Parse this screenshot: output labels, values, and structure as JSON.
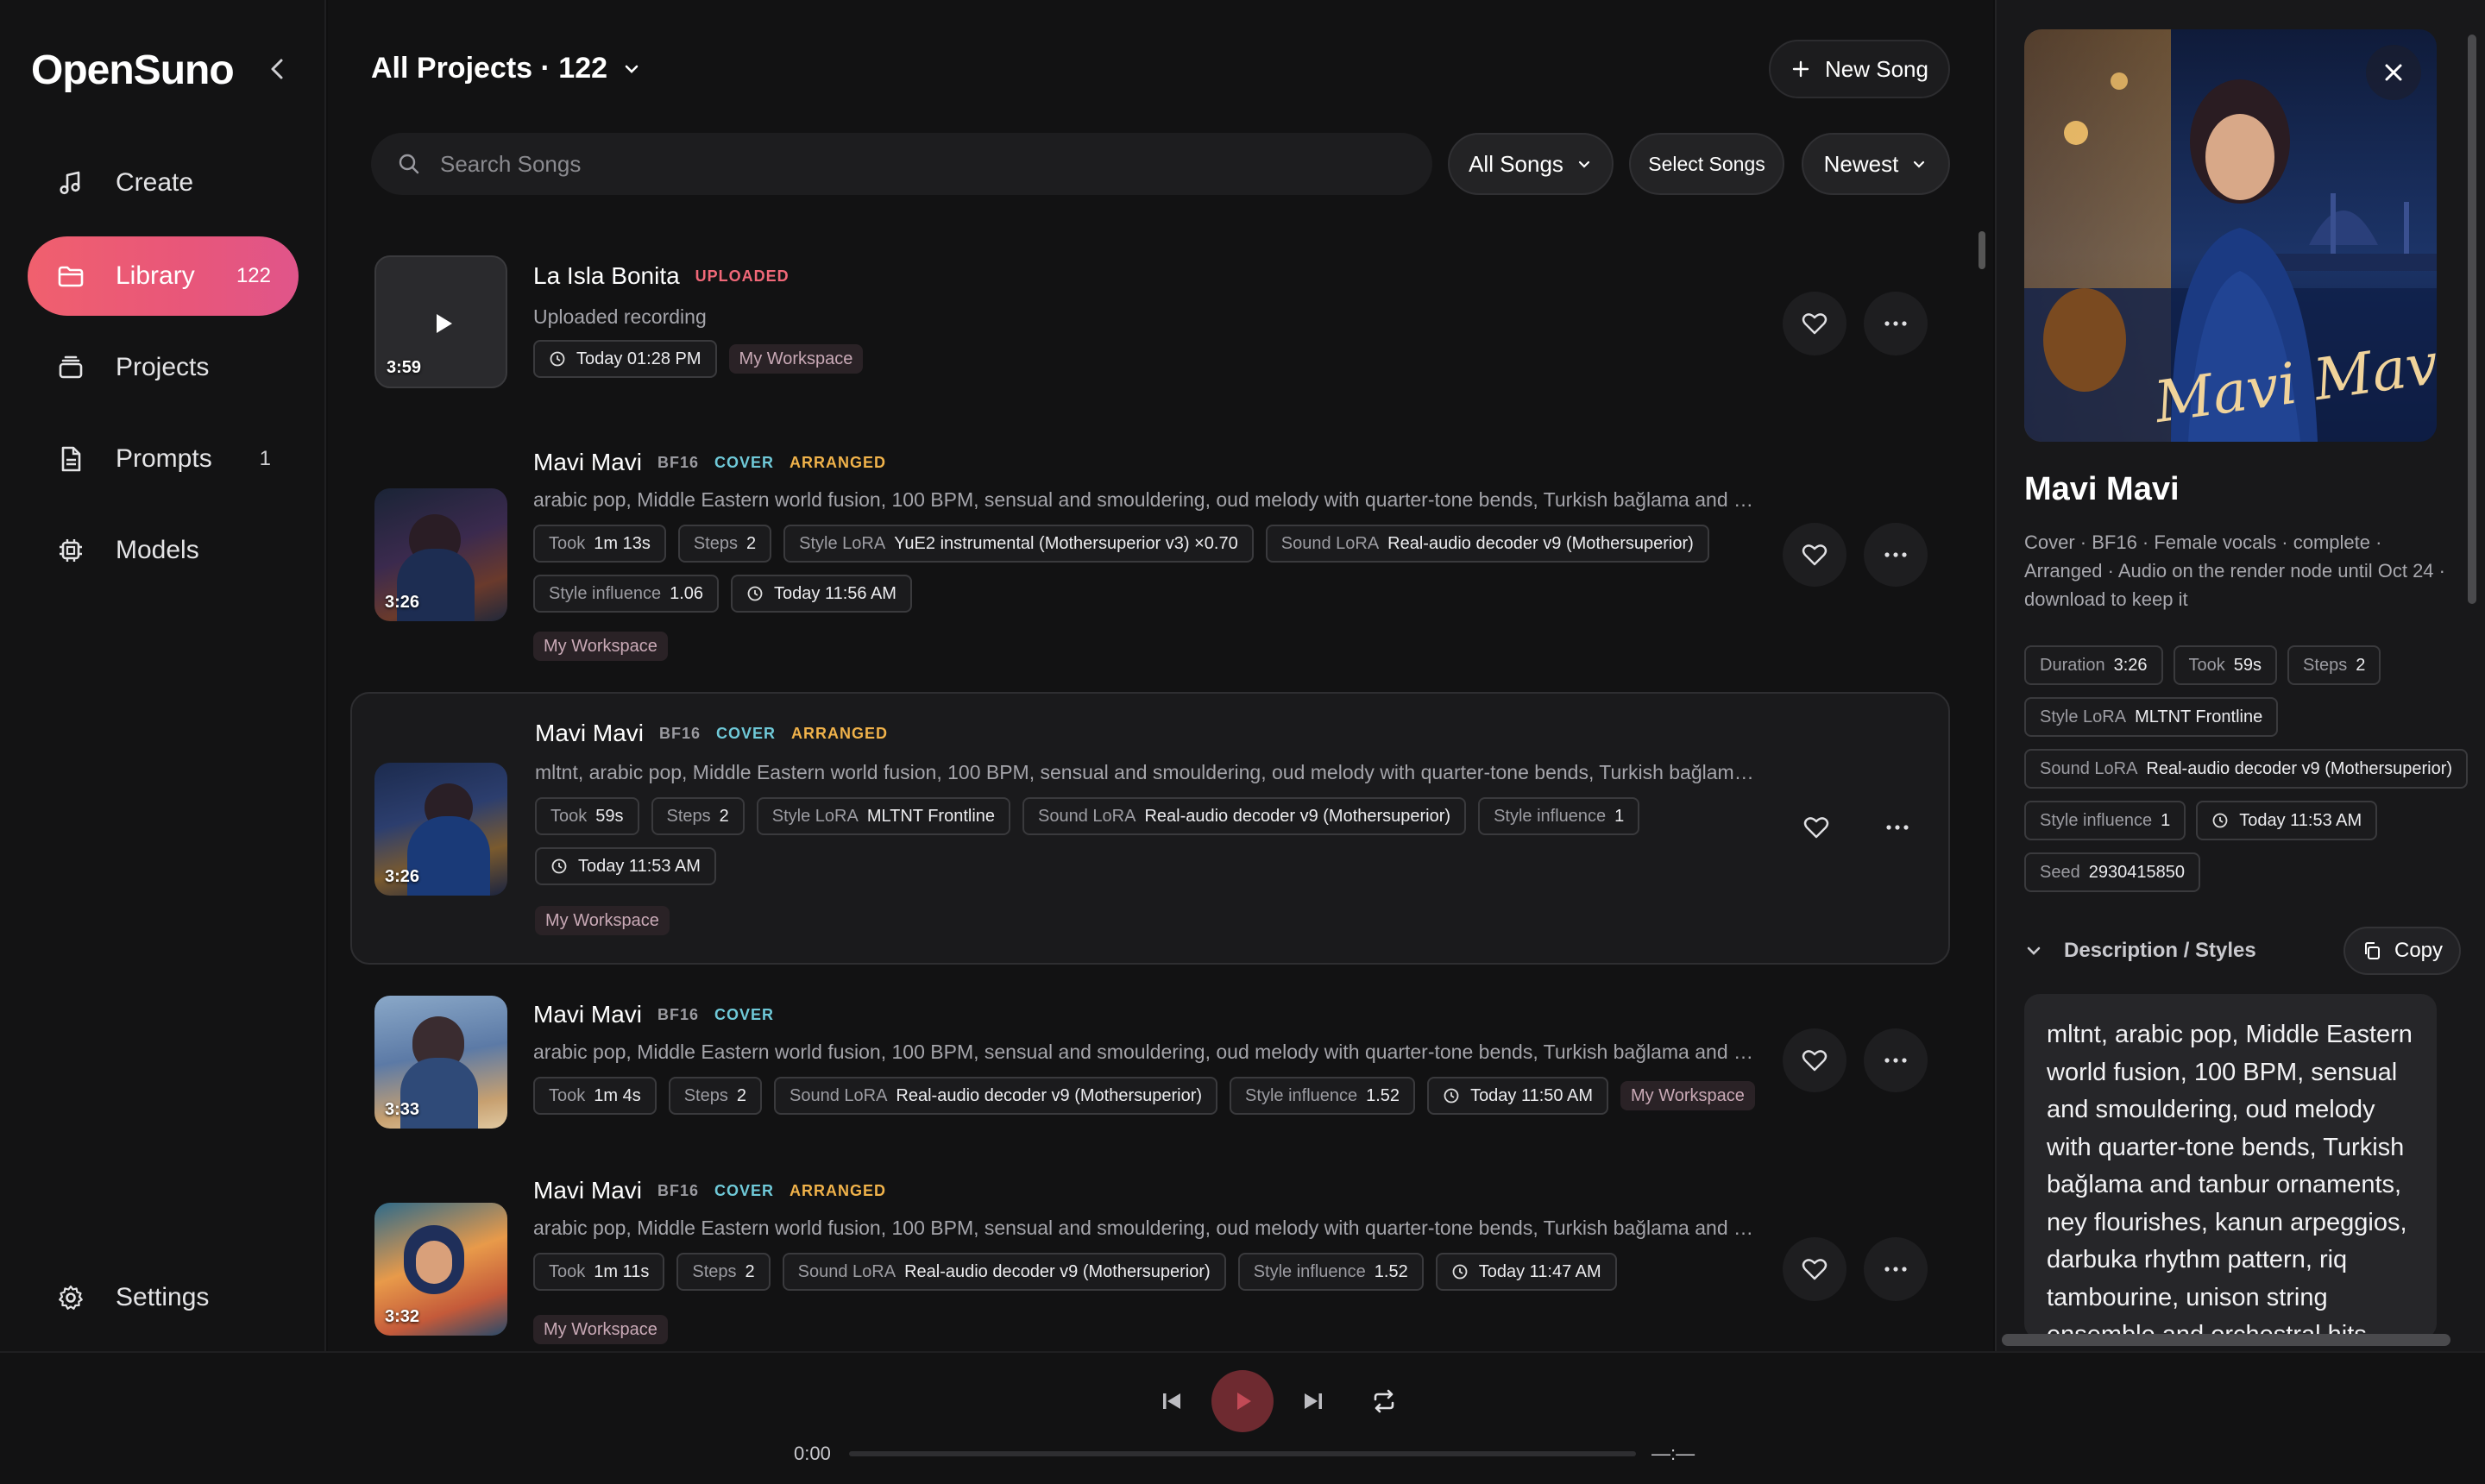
{
  "app": {
    "name": "OpenSuno"
  },
  "sidebar": {
    "items": [
      {
        "label": "Create",
        "icon": "music-note-icon",
        "count": ""
      },
      {
        "label": "Library",
        "icon": "folder-icon",
        "count": "122"
      },
      {
        "label": "Projects",
        "icon": "projects-icon",
        "count": ""
      },
      {
        "label": "Prompts",
        "icon": "document-icon",
        "count": "1"
      },
      {
        "label": "Models",
        "icon": "chip-icon",
        "count": ""
      }
    ],
    "settings_label": "Settings"
  },
  "header": {
    "title": "All Projects · 122",
    "new_song_label": "New Song",
    "search_placeholder": "Search Songs",
    "filter_label": "All Songs",
    "select_label": "Select Songs",
    "sort_label": "Newest"
  },
  "songs": [
    {
      "title": "La Isla Bonita",
      "tags": [
        "UPLOADED"
      ],
      "desc": "Uploaded recording",
      "duration": "3:59",
      "chips": [
        {
          "label": "",
          "value": "Today 01:28 PM",
          "clock": true
        }
      ],
      "workspace": "My Workspace"
    },
    {
      "title": "Mavi Mavi",
      "tags": [
        "BF16",
        "COVER",
        "ARRANGED"
      ],
      "desc": "arabic pop, Middle Eastern world fusion, 100 BPM, sensual and smouldering, oud melody with quarter-tone bends, Turkish bağlama and tanbur ornaments, ney flourishes, kanun arpeggios",
      "duration": "3:26",
      "chips": [
        {
          "label": "Took",
          "value": "1m 13s"
        },
        {
          "label": "Steps",
          "value": "2"
        },
        {
          "label": "Style LoRA",
          "value": "YuE2 instrumental (Mothersuperior v3) ×0.70"
        },
        {
          "label": "Sound LoRA",
          "value": "Real-audio decoder v9 (Mothersuperior)"
        },
        {
          "label": "Style influence",
          "value": "1.06"
        },
        {
          "label": "",
          "value": "Today 11:56 AM",
          "clock": true
        }
      ],
      "workspace": "My Workspace"
    },
    {
      "title": "Mavi Mavi",
      "tags": [
        "BF16",
        "COVER",
        "ARRANGED"
      ],
      "desc": "mltnt, arabic pop, Middle Eastern world fusion, 100 BPM, sensual and smouldering, oud melody with quarter-tone bends, Turkish bağlama and tanbur ornaments, ney flourishes",
      "duration": "3:26",
      "chips": [
        {
          "label": "Took",
          "value": "59s"
        },
        {
          "label": "Steps",
          "value": "2"
        },
        {
          "label": "Style LoRA",
          "value": "MLTNT Frontline"
        },
        {
          "label": "Sound LoRA",
          "value": "Real-audio decoder v9 (Mothersuperior)"
        },
        {
          "label": "Style influence",
          "value": "1"
        },
        {
          "label": "",
          "value": "Today 11:53 AM",
          "clock": true
        }
      ],
      "workspace": "My Workspace"
    },
    {
      "title": "Mavi Mavi",
      "tags": [
        "BF16",
        "COVER"
      ],
      "desc": "arabic pop, Middle Eastern world fusion, 100 BPM, sensual and smouldering, oud melody with quarter-tone bends, Turkish bağlama and tanbur ornaments, ney flourishes, kanun arpeggios",
      "duration": "3:33",
      "chips": [
        {
          "label": "Took",
          "value": "1m 4s"
        },
        {
          "label": "Steps",
          "value": "2"
        },
        {
          "label": "Sound LoRA",
          "value": "Real-audio decoder v9 (Mothersuperior)"
        },
        {
          "label": "Style influence",
          "value": "1.52"
        },
        {
          "label": "",
          "value": "Today 11:50 AM",
          "clock": true
        }
      ],
      "workspace": "My Workspace"
    },
    {
      "title": "Mavi Mavi",
      "tags": [
        "BF16",
        "COVER",
        "ARRANGED"
      ],
      "desc": "arabic pop, Middle Eastern world fusion, 100 BPM, sensual and smouldering, oud melody with quarter-tone bends, Turkish bağlama and tanbur ornaments, ney flourishes, kanun arpeggios",
      "duration": "3:32",
      "chips": [
        {
          "label": "Took",
          "value": "1m 11s"
        },
        {
          "label": "Steps",
          "value": "2"
        },
        {
          "label": "Sound LoRA",
          "value": "Real-audio decoder v9 (Mothersuperior)"
        },
        {
          "label": "Style influence",
          "value": "1.52"
        },
        {
          "label": "",
          "value": "Today 11:47 AM",
          "clock": true
        }
      ],
      "workspace": "My Workspace"
    }
  ],
  "panel": {
    "art_text": "Mavi Mavi",
    "title": "Mavi Mavi",
    "meta": "Cover · BF16 · Female vocals · complete · Arranged · Audio on the render node until Oct 24 · download to keep it",
    "chips": {
      "duration": {
        "label": "Duration",
        "value": "3:26"
      },
      "took": {
        "label": "Took",
        "value": "59s"
      },
      "steps": {
        "label": "Steps",
        "value": "2"
      },
      "style_lora": {
        "label": "Style LoRA",
        "value": "MLTNT Frontline"
      },
      "sound_lora": {
        "label": "Sound LoRA",
        "value": "Real-audio decoder v9 (Mothersuperior)"
      },
      "style_influence": {
        "label": "Style influence",
        "value": "1"
      },
      "date": {
        "value": "Today 11:53 AM"
      },
      "seed": {
        "label": "Seed",
        "value": "2930415850"
      }
    },
    "desc_label": "Description / Styles",
    "copy_label": "Copy",
    "description": "mltnt, arabic pop, Middle Eastern world fusion, 100 BPM, sensual and smouldering, oud melody with quarter-tone bends, Turkish bağlama and tanbur ornaments, ney flourishes, kanun arpeggios, darbuka rhythm pattern, riq tambourine, unison string ensemble and orchestral hits"
  },
  "player": {
    "current_time": "0:00",
    "end_time": "—:—"
  },
  "colors": {
    "accent": "#ee5d74",
    "cover_tag": "#6fc9d8",
    "arranged_tag": "#f0b24a",
    "uploaded_tag": "#f06878"
  }
}
